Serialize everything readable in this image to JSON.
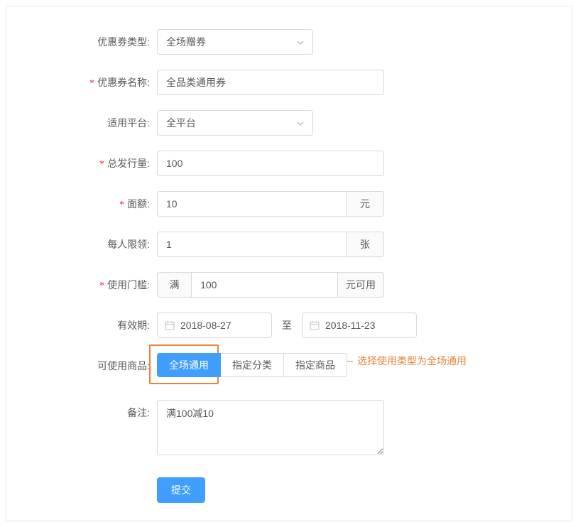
{
  "labels": {
    "coupon_type": "优惠券类型:",
    "coupon_name": "优惠券名称:",
    "platform": "适用平台:",
    "total_issue": "总发行量:",
    "denomination": "面额:",
    "limit_per_person": "每人限领:",
    "threshold": "使用门槛:",
    "validity": "有效期:",
    "usable_goods": "可使用商品:",
    "remark": "备注:"
  },
  "values": {
    "coupon_type": "全场赠券",
    "coupon_name": "全品类通用券",
    "platform": "全平台",
    "total_issue": "100",
    "denomination": "10",
    "limit_per_person": "1",
    "threshold_value": "100",
    "date_start": "2018-08-27",
    "date_end": "2018-11-23",
    "remark": "满100减10"
  },
  "addons": {
    "yuan": "元",
    "zhang": "张",
    "man": "满",
    "yuan_keyong": "元可用",
    "date_to": "至"
  },
  "tabs": {
    "all": "全场通用",
    "category": "指定分类",
    "product": "指定商品"
  },
  "buttons": {
    "submit": "提交"
  },
  "annotation": "选择使用类型为全场通用"
}
